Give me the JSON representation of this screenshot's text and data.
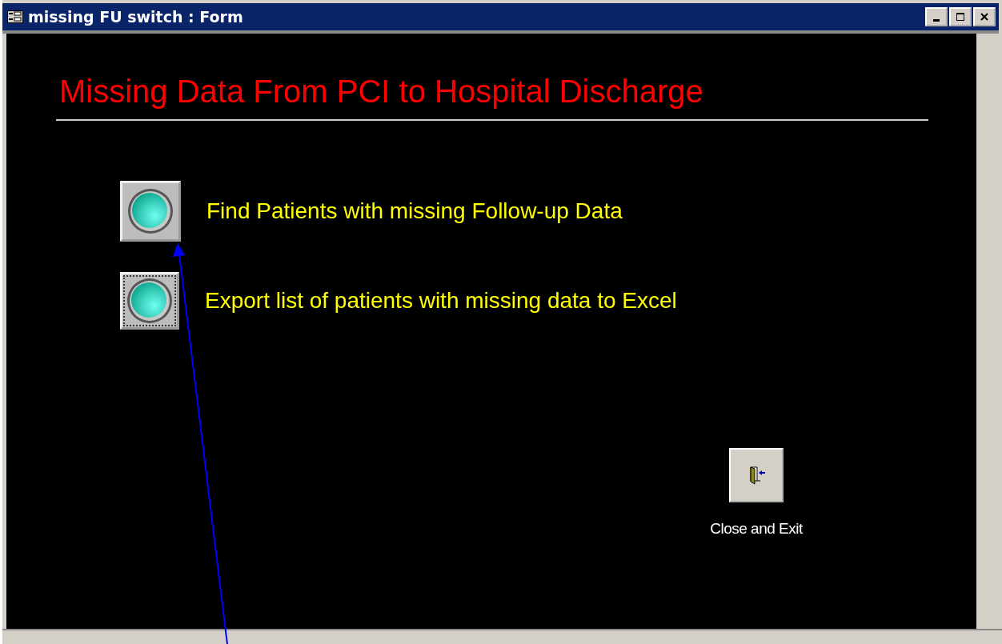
{
  "window": {
    "title": "missing FU switch : Form"
  },
  "heading": "Missing Data From PCI to Hospital Discharge",
  "actions": [
    {
      "label": "Find Patients with missing Follow-up Data",
      "focused": false
    },
    {
      "label": "Export list of patients with missing data to Excel",
      "focused": true
    }
  ],
  "close_button": {
    "label": "Close and Exit"
  }
}
